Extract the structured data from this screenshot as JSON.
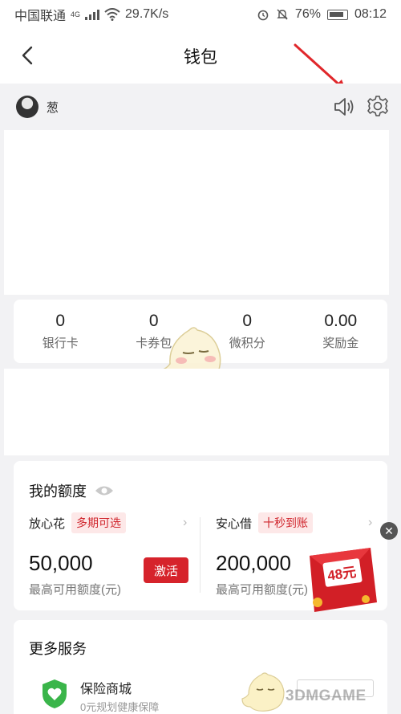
{
  "status": {
    "carrier": "中国联通",
    "network": "4G",
    "speed": "29.7K/s",
    "battery": "76%",
    "time": "08:12"
  },
  "nav": {
    "title": "钱包"
  },
  "user": {
    "name": "葱"
  },
  "stats": [
    {
      "value": "0",
      "label": "银行卡"
    },
    {
      "value": "0",
      "label": "卡券包"
    },
    {
      "value": "0",
      "label": "微积分"
    },
    {
      "value": "0.00",
      "label": "奖励金"
    }
  ],
  "credit": {
    "title": "我的额度",
    "left": {
      "name": "放心花",
      "tag": "多期可选",
      "amount": "50,000",
      "sub": "最高可用额度(元)",
      "button": "激活"
    },
    "right": {
      "name": "安心借",
      "tag": "十秒到账",
      "amount": "200,000",
      "sub": "最高可用额度(元)"
    }
  },
  "promo": {
    "value": "48元"
  },
  "more": {
    "title": "更多服务",
    "service": {
      "name": "保险商城",
      "sub": "0元规划健康保障"
    }
  },
  "watermark": {
    "text": "3DMGAME"
  },
  "colors": {
    "accent": "#d6232b",
    "arrow": "#e0272b"
  }
}
